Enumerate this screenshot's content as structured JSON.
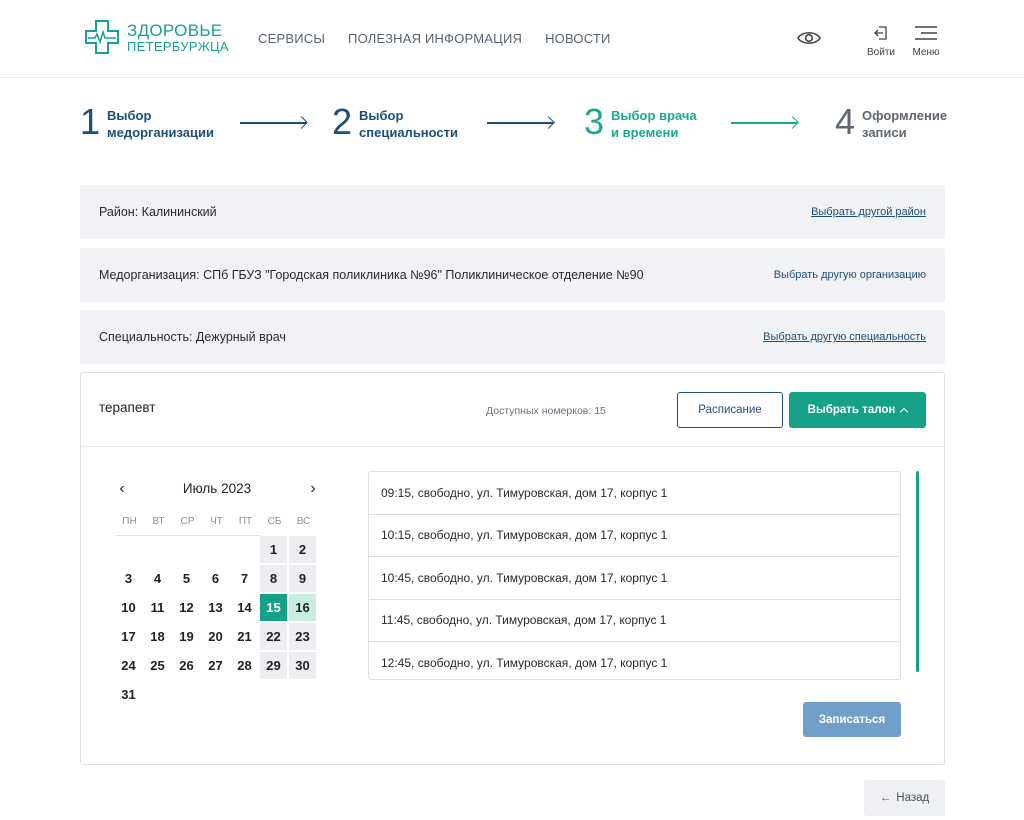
{
  "header": {
    "logo_line1": "ЗДОРОВЬЕ",
    "logo_line2": "ПЕТЕРБУРЖЦА",
    "nav": [
      "СЕРВИСЫ",
      "ПОЛЕЗНАЯ ИНФОРМАЦИЯ",
      "НОВОСТИ"
    ],
    "login_label": "Войти",
    "menu_label": "Меню",
    "accent": "#1b9e96"
  },
  "steps": [
    {
      "num": "1",
      "line1": "Выбор",
      "line2": "медорганизации",
      "state": "done"
    },
    {
      "num": "2",
      "line1": "Выбор",
      "line2": "специальности",
      "state": "done"
    },
    {
      "num": "3",
      "line1": "Выбор врача",
      "line2": "и времени",
      "state": "active"
    },
    {
      "num": "4",
      "line1": "Оформление",
      "line2": "записи",
      "state": "future"
    }
  ],
  "bars": {
    "district": {
      "label": "Район: Калининский",
      "change": "Выбрать другой район"
    },
    "org": {
      "label": "Медорганизация: СПб ГБУЗ \"Городская поликлиника №96\" Поликлиническое отделение №90",
      "change": "Выбрать другую организацию"
    },
    "specialty": {
      "label": "Специальность: Дежурный врач",
      "change": "Выбрать другую специальность"
    }
  },
  "panel": {
    "doctor": "терапевт",
    "available": "Доступных номерков: 15",
    "schedule_button": "Расписание",
    "pick_button": "Выбрать талон",
    "submit_button": "Записаться"
  },
  "calendar": {
    "prev": "‹",
    "next": "›",
    "title": "Июль 2023",
    "weekdays": [
      "ПН",
      "ВТ",
      "СР",
      "ЧТ",
      "ПТ",
      "СБ",
      "ВС"
    ],
    "first_weekday_index": 5,
    "days_in_month": 31,
    "selected_day": 15,
    "highlighted_days": [
      16
    ],
    "primary_color": "#16a085"
  },
  "slots": [
    "09:15, свободно, ул. Тимуровская, дом 17, корпус 1",
    "10:15, свободно, ул. Тимуровская, дом 17, корпус 1",
    "10:45, свободно, ул. Тимуровская, дом 17, корпус 1",
    "11:45, свободно, ул. Тимуровская, дом 17, корпус 1",
    "12:45, свободно, ул. Тимуровская, дом 17, корпус 1"
  ],
  "back_button": "Назад"
}
